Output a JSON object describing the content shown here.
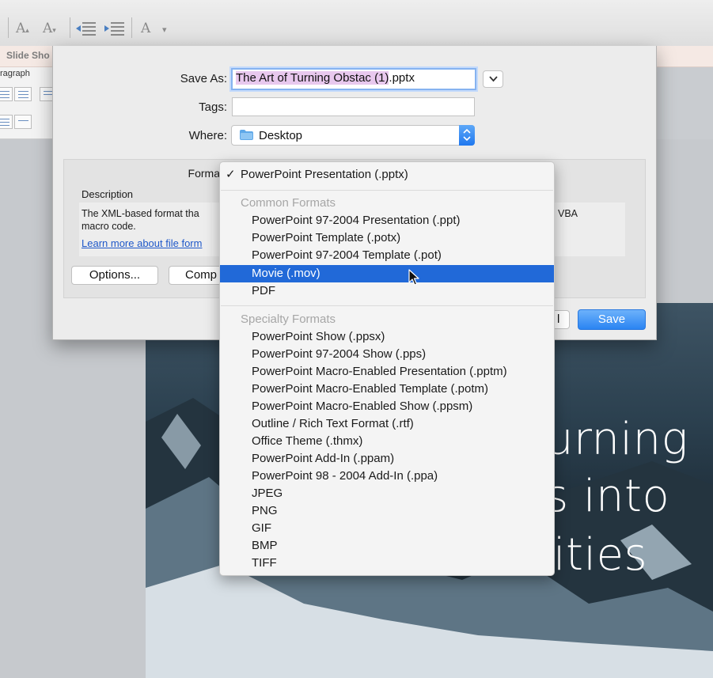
{
  "ribbon": {
    "font_up_label": "A",
    "font_down_label": "A",
    "clear_format_label": "A",
    "font_up_suffix": "▴",
    "font_down_suffix": "▾",
    "dropdown_glyph": "▾"
  },
  "tabs": {
    "slide_show": "Slide Sho"
  },
  "ribbon_group": {
    "paragraph": "ragraph"
  },
  "dialog": {
    "save_as_label": "Save As:",
    "save_as_value_selected": "The Art of Turning Obstac (1)",
    "save_as_value_ext": ".pptx",
    "tags_label": "Tags:",
    "tags_value": "",
    "where_label": "Where:",
    "where_value": "Desktop",
    "format_label": "Forma",
    "description_label": "Description",
    "description_text_1": "The XML-based format tha",
    "description_text_2": "macro code.",
    "description_right": "VBA",
    "learn_more": "Learn more about file form",
    "options_button": "Options...",
    "compatibility_button": "Comp",
    "cancel_button_stub": "l",
    "save_button": "Save"
  },
  "format_menu": {
    "checked_item": "PowerPoint Presentation (.pptx)",
    "check_glyph": "✓",
    "common_header": "Common Formats",
    "common_items": [
      "PowerPoint 97-2004 Presentation (.ppt)",
      "PowerPoint Template (.potx)",
      "PowerPoint 97-2004 Template (.pot)",
      "Movie (.mov)",
      "PDF"
    ],
    "highlighted_item": "Movie (.mov)",
    "specialty_header": "Specialty Formats",
    "specialty_items": [
      "PowerPoint Show (.ppsx)",
      "PowerPoint 97-2004 Show (.pps)",
      "PowerPoint Macro-Enabled Presentation (.pptm)",
      "PowerPoint Macro-Enabled Template (.potm)",
      "PowerPoint Macro-Enabled Show (.ppsm)",
      "Outline / Rich Text Format (.rtf)",
      "Office Theme (.thmx)",
      "PowerPoint Add-In (.ppam)",
      "PowerPoint 98 - 2004 Add-In (.ppa)",
      "JPEG",
      "PNG",
      "GIF",
      "BMP",
      "TIFF"
    ]
  },
  "slide": {
    "line1": "urning",
    "line2": "s into",
    "line3": "ities"
  },
  "colors": {
    "accent_blue": "#2169d8",
    "save_button": "#2a84f2",
    "selection_pink": "#e8c8ee",
    "link_blue": "#1f58c9"
  }
}
